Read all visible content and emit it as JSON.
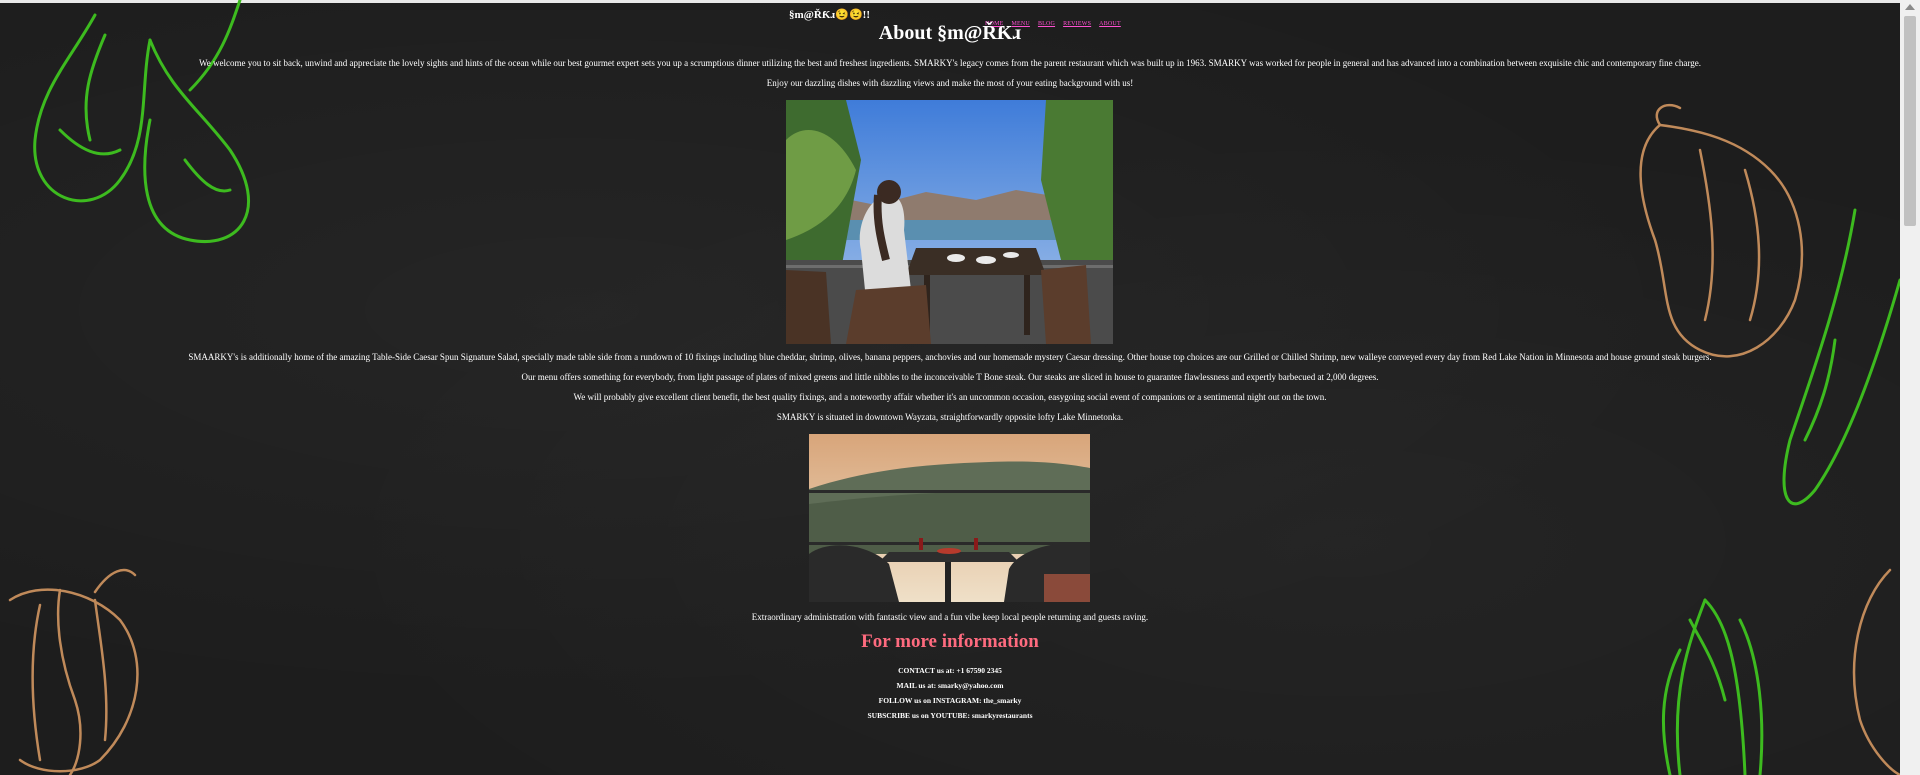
{
  "header": {
    "brand": "§m@ŘƘɹ😉😉!!",
    "nav": [
      {
        "label": "HOME"
      },
      {
        "label": "MENU"
      },
      {
        "label": "BLOG"
      },
      {
        "label": "REVIEWS"
      },
      {
        "label": "ABOUT"
      }
    ]
  },
  "main": {
    "title": "About §m@ŘƘɹ",
    "intro": [
      "We welcome you to sit back, unwind and appreciate the lovely sights and hints of the ocean while our best gourmet expert sets you up a scrumptious dinner utilizing the best and freshest ingredients. SMARKY's legacy comes from the parent restaurant which was built up in 1963. SMARKY was worked for people in general and has advanced into a combination between exquisite chic and contemporary fine charge.",
      "Enjoy our dazzling dishes with dazzling views and make the most of your eating background with us!"
    ],
    "body": [
      "SMAARKY's is additionally home of the amazing Table-Side Caesar Spun Signature Salad, specially made table side from a rundown of 10 fixings including blue cheddar, shrimp, olives, banana peppers, anchovies and our homemade mystery Caesar dressing. Other house top choices are our Grilled or Chilled Shrimp, new walleye conveyed every day from Red Lake Nation in Minnesota and house ground steak burgers.",
      "Our menu offers something for everybody, from light passage of plates of mixed greens and little nibbles to the inconceivable T Bone steak. Our steaks are sliced in house to guarantee flawlessness and expertly barbecued at 2,000 degrees.",
      "We will probably give excellent client benefit, the best quality fixings, and a noteworthy affair whether it's an uncommon occasion, easygoing social event of companions or a sentimental night out on the town.",
      "SMARKY is situated in downtown Wayzata, straightforwardly opposite lofty Lake Minnetonka."
    ],
    "closing": "Extraordinary administration with fantastic view and a fun vibe keep local people returning and guests raving."
  },
  "info": {
    "heading": "For more information",
    "lines": [
      "CONTACT us at: +1 67590 2345",
      "MAIL us at: smarky@yahoo.com",
      "FOLLOW us on INSTAGRAM: the_smarky",
      "SUBSCRIBE us on YOUTUBE: smarkyrestaurants"
    ]
  },
  "colors": {
    "background": "#1d1d1d",
    "nav_link": "#ff4fd2",
    "info_heading": "#ff6b7f",
    "decor_green": "#3dbb1f",
    "decor_tan": "#c08a5a"
  }
}
